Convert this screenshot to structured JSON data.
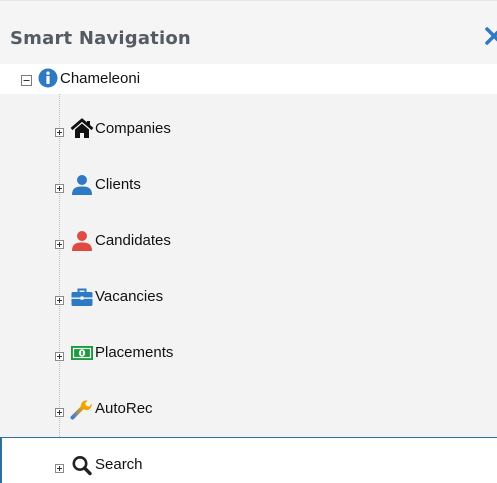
{
  "header": {
    "title": "Smart Navigation",
    "close_icon": "close-icon"
  },
  "tree": {
    "root": {
      "label": "Chameleoni",
      "icon": "info-circle-icon",
      "expanded": true
    },
    "children": [
      {
        "id": "companies",
        "label": "Companies",
        "icon": "home-icon"
      },
      {
        "id": "clients",
        "label": "Clients",
        "icon": "user-icon"
      },
      {
        "id": "candidates",
        "label": "Candidates",
        "icon": "user-icon"
      },
      {
        "id": "vacancies",
        "label": "Vacancies",
        "icon": "briefcase-icon"
      },
      {
        "id": "placements",
        "label": "Placements",
        "icon": "money-icon"
      },
      {
        "id": "autorec",
        "label": "AutoRec",
        "icon": "wrench-icon"
      },
      {
        "id": "search",
        "label": "Search",
        "icon": "search-icon",
        "selected": true
      }
    ]
  },
  "colors": {
    "header_text": "#555b63",
    "accent_blue": "#2f78c4",
    "candidate_red": "#e04a43",
    "placement_green": "#1a9b3c",
    "selection_border": "#2f6fa0"
  }
}
